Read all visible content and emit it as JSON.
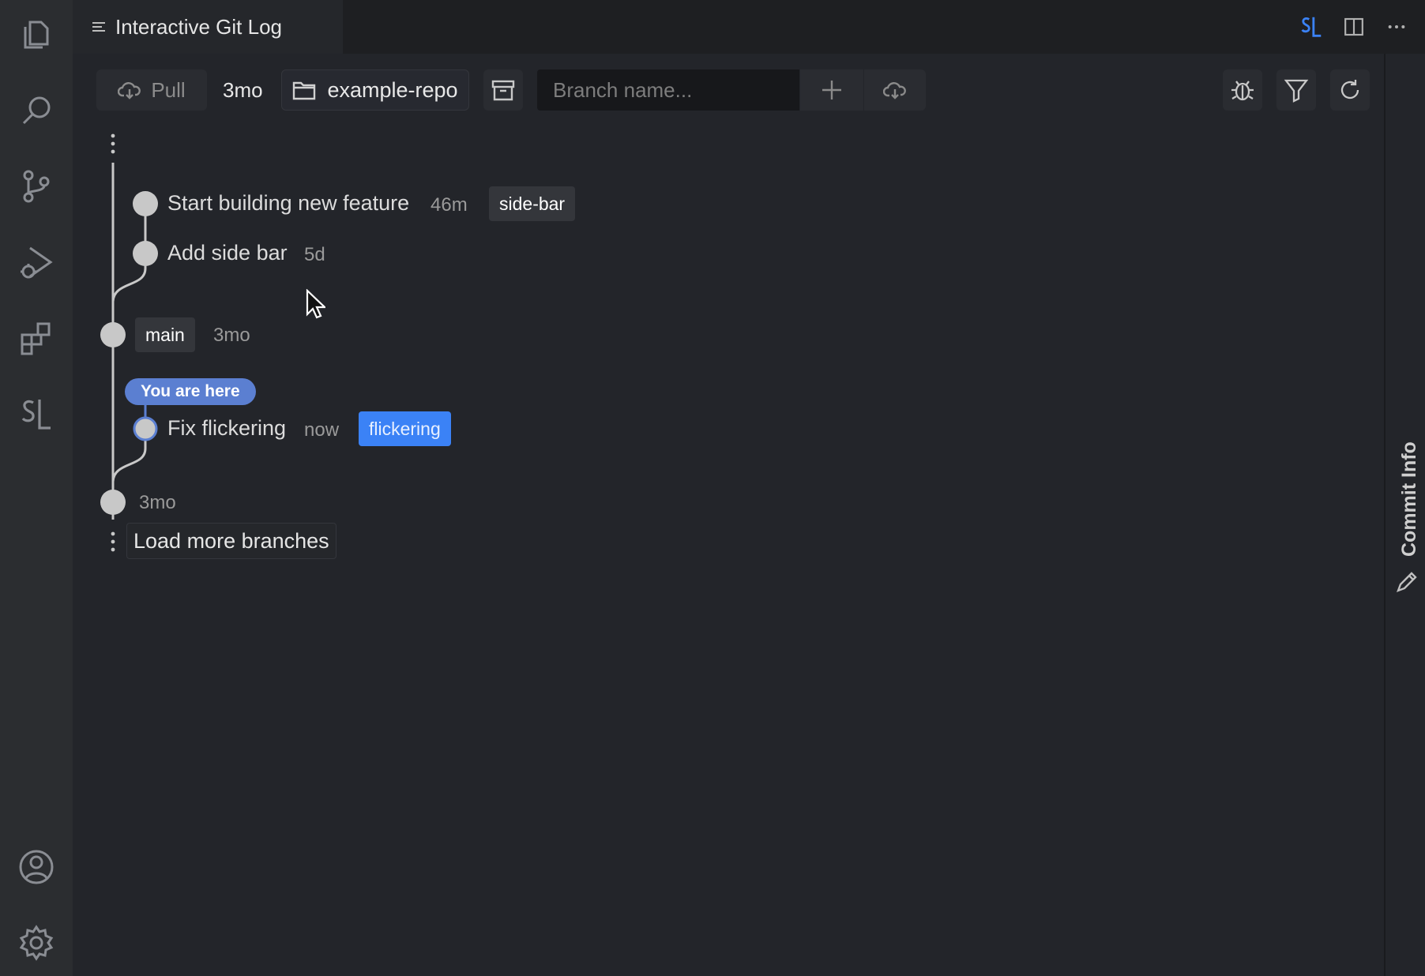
{
  "tab": {
    "title": "Interactive Git Log"
  },
  "toolbar": {
    "pull_label": "Pull",
    "since": "3mo",
    "repo": "example-repo",
    "branch_placeholder": "Branch name..."
  },
  "commits": [
    {
      "message": "Start building new feature",
      "age": "46m",
      "branch": "side-bar"
    },
    {
      "message": "Add side bar",
      "age": "5d"
    },
    {
      "branch": "main",
      "age": "3mo"
    },
    {
      "message": "Fix flickering",
      "age": "now",
      "branch": "flickering",
      "badge": "You are here"
    },
    {
      "age": "3mo"
    }
  ],
  "load_more": "Load more branches",
  "side_panel": {
    "label": "Commit Info"
  },
  "colors": {
    "accent": "#3b82f6",
    "here_badge": "#5b7fd1",
    "node": "#c8c8c8"
  },
  "icons": {
    "activity": [
      "explorer-icon",
      "search-icon",
      "source-control-icon",
      "run-debug-icon",
      "extensions-icon",
      "gitlog-icon",
      "account-icon",
      "settings-gear-icon"
    ],
    "tab_actions": [
      "gitlog-icon",
      "split-editor-icon",
      "more-actions-icon"
    ]
  }
}
